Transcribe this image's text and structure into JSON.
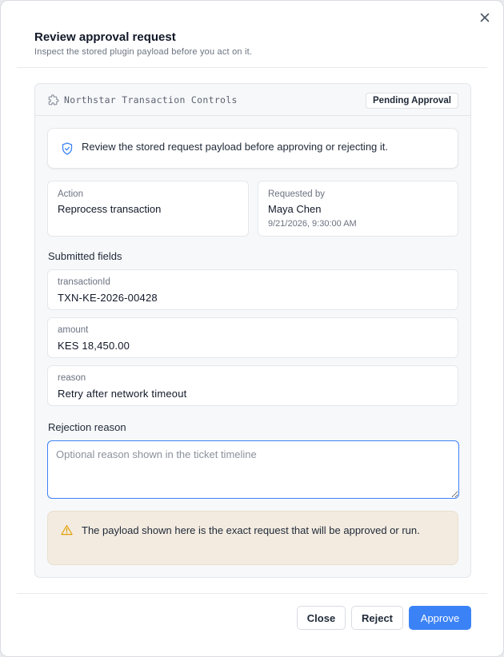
{
  "dialog": {
    "title": "Review approval request",
    "subtitle": "Inspect the stored plugin payload before you act on it."
  },
  "plugin": {
    "name": "Northstar Transaction Controls",
    "status": "Pending Approval"
  },
  "notice": {
    "text": "Review the stored request payload before approving or rejecting it."
  },
  "action": {
    "label": "Action",
    "value": "Reprocess transaction"
  },
  "requested_by": {
    "label": "Requested by",
    "name": "Maya Chen",
    "timestamp": "9/21/2026, 9:30:00 AM"
  },
  "submitted_fields": {
    "heading": "Submitted fields",
    "items": [
      {
        "label": "transactionId",
        "value": "TXN-KE-2026-00428"
      },
      {
        "label": "amount",
        "value": "KES 18,450.00"
      },
      {
        "label": "reason",
        "value": "Retry after network timeout"
      }
    ]
  },
  "rejection": {
    "label": "Rejection reason",
    "placeholder": "Optional reason shown in the ticket timeline",
    "value": ""
  },
  "warning": {
    "text": "The payload shown here is the exact request that will be approved or run."
  },
  "buttons": {
    "close": "Close",
    "reject": "Reject",
    "approve": "Approve"
  },
  "icons": {
    "close": "close-icon",
    "plugin": "puzzle-icon",
    "notice": "shield-icon",
    "warning": "warning-icon"
  },
  "colors": {
    "accent": "#3b82f6",
    "warning_bg": "#f3ebe0",
    "warning_icon": "#e3a008",
    "notice_icon": "#3b82f6"
  }
}
